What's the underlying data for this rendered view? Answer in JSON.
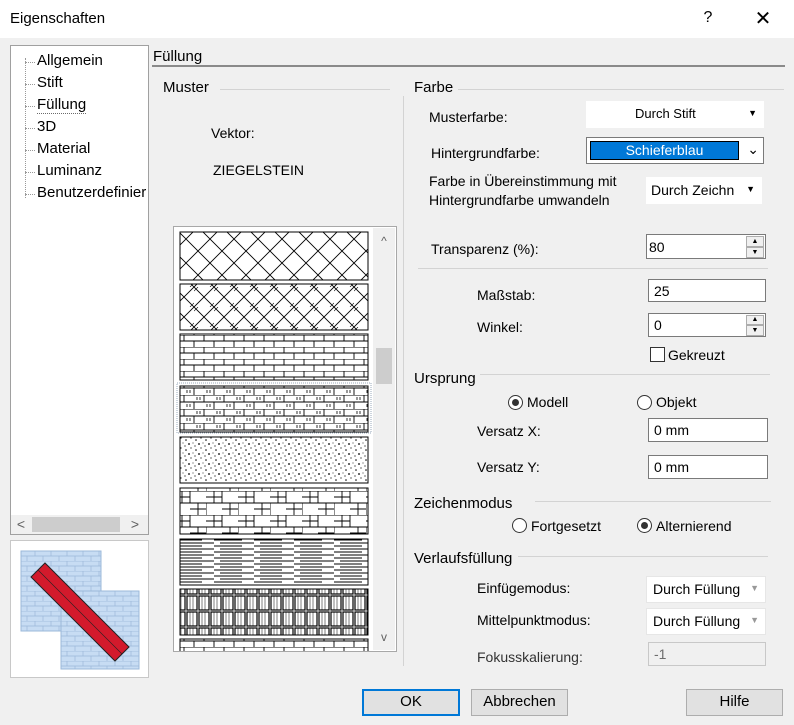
{
  "window": {
    "title": "Eigenschaften",
    "help": "?",
    "close": "✕"
  },
  "tree": {
    "items": [
      "Allgemein",
      "Stift",
      "Füllung",
      "3D",
      "Material",
      "Luminanz",
      "Benutzerdefinier"
    ],
    "selected": "Füllung",
    "scroll_left": "<",
    "scroll_right": ">"
  },
  "tab": {
    "title": "Füllung"
  },
  "muster": {
    "head": "Muster",
    "vector_label": "Vektor:",
    "pattern_name": "ZIEGELSTEIN",
    "scroll_up": "^",
    "scroll_down": "v"
  },
  "farbe": {
    "head": "Farbe",
    "musterfarbe_label": "Musterfarbe:",
    "musterfarbe_value": "Durch Stift",
    "hintergrund_label": "Hintergrundfarbe:",
    "hintergrund_value": "Schieferblau",
    "hintergrund_swatch": "#0078d7",
    "convert_label_1": "Farbe in Übereinstimmung mit",
    "convert_label_2": "Hintergrundfarbe umwandeln",
    "convert_value": "Durch Zeichn",
    "transparenz_label": "Transparenz (%):",
    "transparenz_value": "80",
    "massstab_label": "Maßstab:",
    "massstab_value": "25",
    "winkel_label": "Winkel:",
    "winkel_value": "0",
    "gekreuzt_label": "Gekreuzt",
    "gekreuzt_checked": false
  },
  "ursprung": {
    "head": "Ursprung",
    "modell": "Modell",
    "objekt": "Objekt",
    "selected": "Modell",
    "versatz_x_label": "Versatz X:",
    "versatz_x_value": "0 mm",
    "versatz_y_label": "Versatz Y:",
    "versatz_y_value": "0 mm"
  },
  "zeichenmodus": {
    "head": "Zeichenmodus",
    "fortgesetzt": "Fortgesetzt",
    "alternierend": "Alternierend",
    "selected": "Alternierend"
  },
  "verlauf": {
    "head": "Verlaufsfüllung",
    "einfuege_label": "Einfügemodus:",
    "einfuege_value": "Durch Füllung",
    "mittelpunkt_label": "Mittelpunktmodus:",
    "mittelpunkt_value": "Durch Füllung",
    "fokus_label": "Fokusskalierung:",
    "fokus_value": "-1"
  },
  "buttons": {
    "ok": "OK",
    "cancel": "Abbrechen",
    "help": "Hilfe"
  },
  "colors": {
    "accent": "#0078d7",
    "preview_blue": "#c7dcf3",
    "preview_red": "#d31a2c"
  }
}
